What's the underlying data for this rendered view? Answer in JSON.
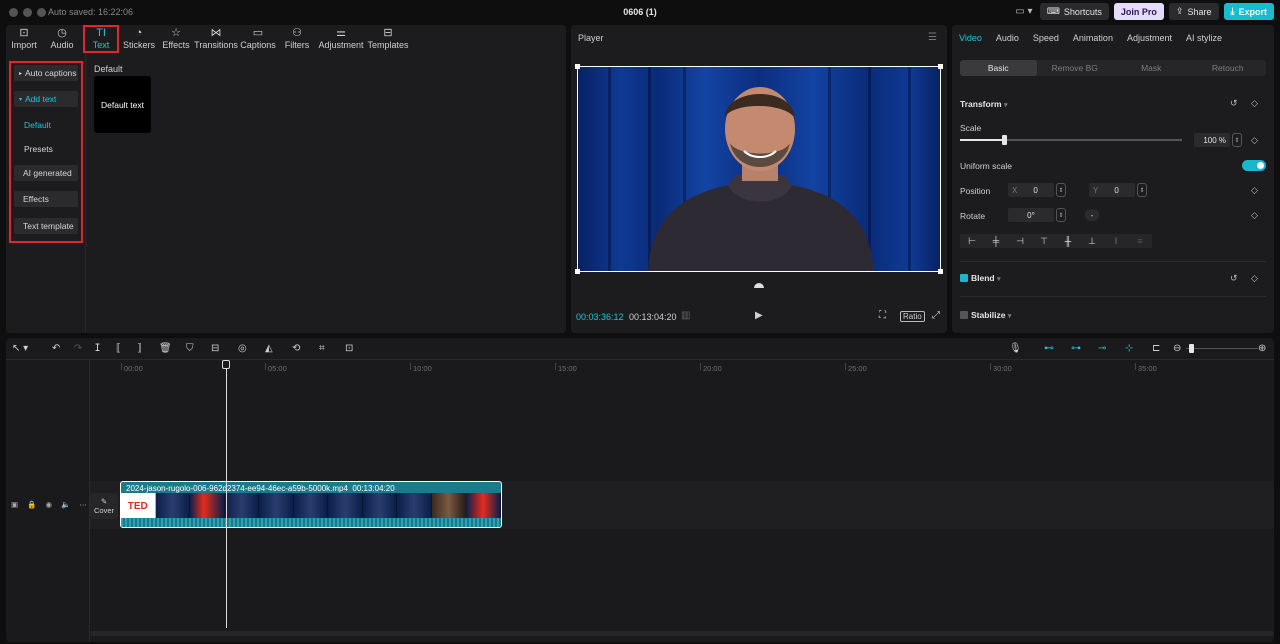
{
  "titlebar": {
    "autosave": "Auto saved: 16:22:06",
    "title": "0606 (1)",
    "shortcuts": "Shortcuts",
    "join_pro": "Join Pro",
    "share": "Share",
    "export": "Export"
  },
  "toolbar": {
    "items": [
      {
        "label": "Import",
        "icon": "import-icon"
      },
      {
        "label": "Audio",
        "icon": "audio-icon"
      },
      {
        "label": "Text",
        "icon": "text-icon",
        "active": true
      },
      {
        "label": "Stickers",
        "icon": "sticker-icon"
      },
      {
        "label": "Effects",
        "icon": "effects-icon"
      },
      {
        "label": "Transitions",
        "icon": "transitions-icon"
      },
      {
        "label": "Captions",
        "icon": "captions-icon"
      },
      {
        "label": "Filters",
        "icon": "filters-icon"
      },
      {
        "label": "Adjustment",
        "icon": "adjustment-icon"
      },
      {
        "label": "Templates",
        "icon": "templates-icon"
      }
    ]
  },
  "text_sidebar": {
    "auto_captions": "Auto captions",
    "add_text": "Add text",
    "default": "Default",
    "presets": "Presets",
    "ai_generated": "AI generated",
    "effects": "Effects",
    "text_template": "Text template"
  },
  "text_main": {
    "section_label": "Default",
    "tile_label": "Default text"
  },
  "player": {
    "title": "Player",
    "current_time": "00:03:36:12",
    "total_time": "00:13:04:20",
    "ratio": "Ratio"
  },
  "inspector": {
    "tabs": [
      "Video",
      "Audio",
      "Speed",
      "Animation",
      "Adjustment",
      "AI stylize"
    ],
    "subtabs": [
      "Basic",
      "Remove BG",
      "Mask",
      "Retouch"
    ],
    "transform": "Transform",
    "scale_label": "Scale",
    "scale_value": "100 %",
    "scale_fraction": 0.2,
    "uniform_scale": "Uniform scale",
    "position_label": "Position",
    "x_label": "X",
    "x_value": "0",
    "y_label": "Y",
    "y_value": "0",
    "rotate_label": "Rotate",
    "rotate_value": "0°",
    "blend": "Blend",
    "stabilize": "Stabilize"
  },
  "timeline": {
    "ticks": [
      "00:00",
      "05:00",
      "10:00",
      "15:00",
      "20:00",
      "25:00",
      "30:00",
      "35:00"
    ],
    "clip_name": "2024-jason-rugolo-006-962d2374-ee94-46ec-a59b-5000k.mp4",
    "clip_duration": "00:13:04:20",
    "cover": "Cover",
    "ted": "TED"
  },
  "colors": {
    "accent": "#20c5d8",
    "highlight": "#e0272a",
    "clip": "#1b7b8a"
  }
}
